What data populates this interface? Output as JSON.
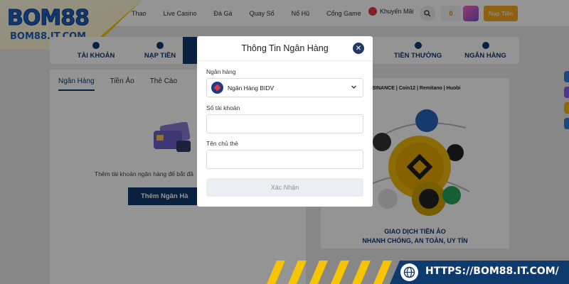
{
  "brand": {
    "logo_text": "BOM88",
    "logo_url": "BOM88.IT.COM"
  },
  "topnav": {
    "links": [
      "Thao",
      "Live Casino",
      "Đá Gà",
      "Quay Số",
      "Nổ Hũ",
      "Cổng Game"
    ],
    "promo_label": "Khuyến Mãi",
    "balance": "0",
    "deposit_label": "Nạp Tiền"
  },
  "account_tabs": {
    "items": [
      {
        "label": "TÀI KHOẢN",
        "icon": "user-icon"
      },
      {
        "label": "NẠP TIỀN",
        "icon": "plus-circle-icon"
      },
      {
        "label": "TIỀN THƯỞNG",
        "icon": "gift-icon"
      },
      {
        "label": "NGÂN HÀNG",
        "icon": "bank-icon"
      }
    ]
  },
  "bank_panel": {
    "subtabs": [
      "Ngân Hàng",
      "Tiền Ảo",
      "Thẻ Cào"
    ],
    "empty_text": "Thêm tài khoản ngân hàng để bắt đầ",
    "add_button": "Thêm Ngân Hà"
  },
  "crypto_promo": {
    "brands": "BINANCE | Coin12 | Remitano | Huobi",
    "caption_line1": "GIAO DỊCH TIỀN ẢO",
    "caption_line2": "NHANH CHÓNG, AN TOÀN, UY TÍN"
  },
  "modal": {
    "title": "Thông Tin Ngân Hàng",
    "bank_label": "Ngân hàng",
    "bank_selected": "Ngân Hàng BIDV",
    "account_number_label": "Số tài khoản",
    "account_number_value": "",
    "holder_name_label": "Tên chủ thẻ",
    "holder_name_value": "",
    "confirm_label": "Xác Nhận"
  },
  "banner": {
    "url": "HTTPS://BOM88.IT.COM/"
  },
  "colors": {
    "primary_navy": "#0e3a6e",
    "accent_orange": "#f5a623",
    "logo_blue": "#1f5fbf",
    "stripe_yellow": "#f6c500"
  }
}
